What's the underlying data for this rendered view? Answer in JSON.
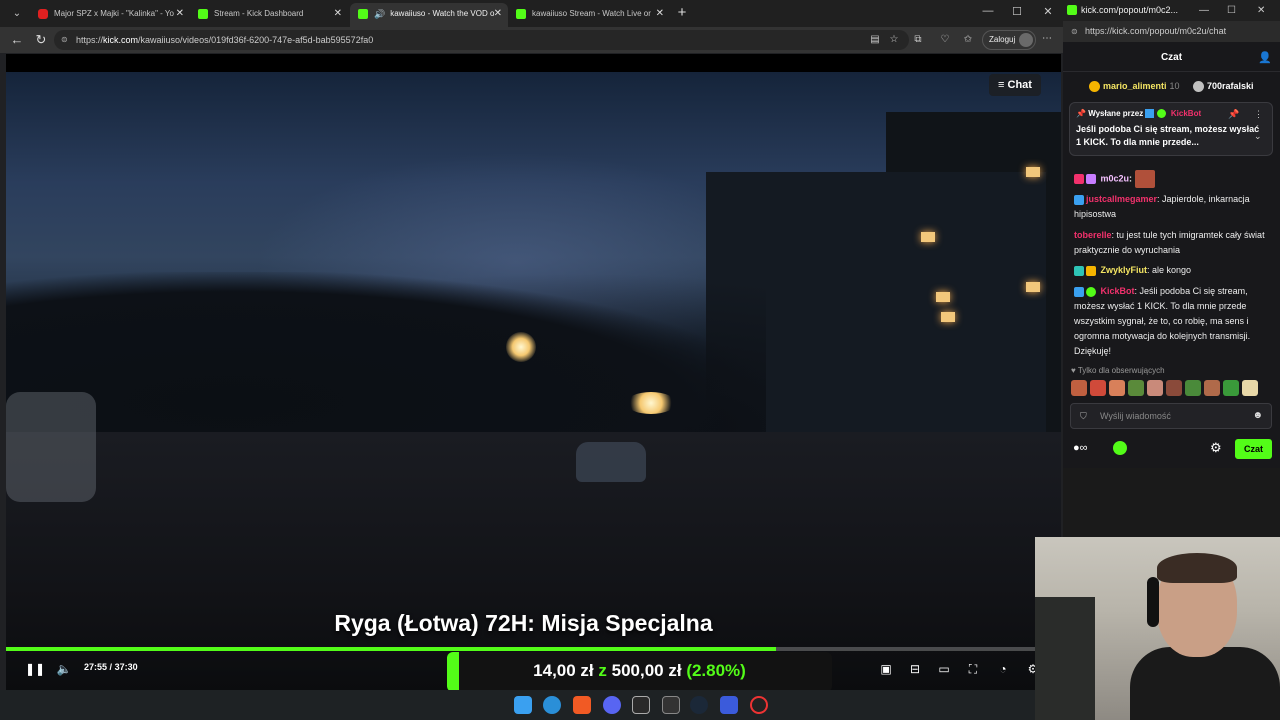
{
  "browser": {
    "tabs": [
      {
        "title": "Major SPZ x Majki - \"Kalinka\" - Yo",
        "icon": "youtube-icon"
      },
      {
        "title": "Stream - Kick Dashboard",
        "icon": "kick-icon"
      },
      {
        "title": "kawaiiuso - Watch the VOD o",
        "icon": "kick-icon",
        "active": true,
        "audio": true
      },
      {
        "title": "kawaiiuso Stream - Watch Live or",
        "icon": "kick-icon"
      }
    ],
    "url_prefix": "https://",
    "url_host": "kick.com",
    "url_path": "/kawaiiuso/videos/019fd36f-6200-747e-af5d-bab595572fa0",
    "login_label": "Zaloguj"
  },
  "player": {
    "chat_toggle": "Chat",
    "vod_title": "Ryga (Łotwa) 72H: Misja Specjalna",
    "current_time": "27:55",
    "time_sep": "/",
    "duration": "37:30",
    "progress_fraction": 0.744
  },
  "goal": {
    "current": "14,00 zł",
    "sep": "z",
    "target": "500,00 zł",
    "percent": "(2.80%)",
    "fill_fraction": 0.028
  },
  "chat": {
    "window_title": "kick.com/popout/m0c2...",
    "url": "https://kick.com/popout/m0c2u/chat",
    "header": "Czat",
    "top_gifters": [
      {
        "name": "mario_alimenti",
        "count": "10"
      },
      {
        "name": "700rafalski",
        "count": ""
      }
    ],
    "pinned": {
      "label": "Wysłane przez",
      "author": "KickBot",
      "text": "Jeśli podoba Ci się stream, możesz wysłać 1 KICK. To dla mnie przede..."
    },
    "messages": [
      {
        "user": "m0c2u",
        "text": "",
        "color": "#f4c1ff"
      },
      {
        "user": "justcallmegamer",
        "text": ": Japierdole, inkarnacja hipisostwa",
        "color": "#f2316c"
      },
      {
        "user": "toberelle",
        "text": ": tu jest tule tych imigramtek cały świat praktycznie do wyruchania",
        "color": "#f2316c"
      },
      {
        "user": "ZwyklyFiut",
        "text": ": ale kongo",
        "color": "#f5e663"
      },
      {
        "user": "KickBot",
        "text": ": Jeśli podoba Ci się stream, możesz wysłać 1 KICK. To dla mnie przede wszystkim sygnał, że to, co robię, ma sens i ogromna motywacja do kolejnych transmisji. Dziękuję!",
        "color": "#f2316c"
      }
    ],
    "followers_only": "Tylko dla obserwujących",
    "input_placeholder": "Wyślij wiadomość",
    "send_label": "Czat"
  },
  "colors": {
    "kick_green": "#53fc18",
    "chat_bg": "#18181b",
    "red_user": "#f2316c"
  }
}
